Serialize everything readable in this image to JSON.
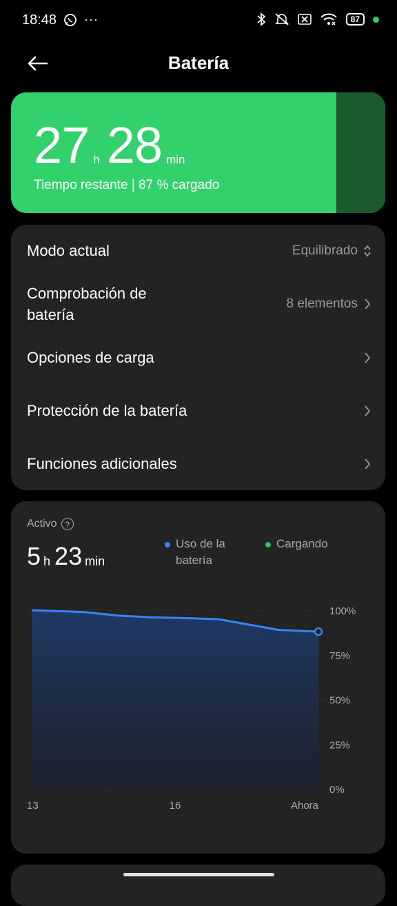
{
  "status_bar": {
    "time": "18:48",
    "battery": "87"
  },
  "header": {
    "title": "Batería"
  },
  "battery_card": {
    "hours": "27",
    "hours_unit": "h",
    "minutes": "28",
    "minutes_unit": "min",
    "subtitle": "Tiempo restante | 87 % cargado",
    "charge_level_pct": 87,
    "accent_color": "#33d16c"
  },
  "settings": [
    {
      "label": "Modo actual",
      "value": "Equilibrado",
      "icon": "updown-chevron-icon"
    },
    {
      "label": "Comprobación de batería",
      "value": "8 elementos",
      "icon": "chevron-right-icon"
    },
    {
      "label": "Opciones de carga",
      "value": "",
      "icon": "chevron-right-icon"
    },
    {
      "label": "Protección de la batería",
      "value": "",
      "icon": "chevron-right-icon"
    },
    {
      "label": "Funciones adicionales",
      "value": "",
      "icon": "chevron-right-icon"
    }
  ],
  "usage": {
    "active_label": "Activo",
    "hours": "5",
    "hours_unit": "h",
    "minutes": "23",
    "minutes_unit": "min",
    "legend": [
      {
        "label": "Uso de la batería",
        "color": "#3b82f6"
      },
      {
        "label": "Cargando",
        "color": "#22c55e"
      }
    ]
  },
  "chart_data": {
    "type": "area",
    "x_ticks": [
      "13",
      "16",
      "Ahora"
    ],
    "y_ticks": [
      "100%",
      "75%",
      "50%",
      "25%",
      "0%"
    ],
    "ylim": [
      0,
      100
    ],
    "series": [
      {
        "name": "Uso de la batería",
        "x": [
          0,
          0.18,
          0.3,
          0.42,
          0.55,
          0.65,
          0.72,
          0.86,
          1
        ],
        "values": [
          100,
          99,
          97,
          96,
          95.5,
          95,
          93,
          89,
          88
        ]
      }
    ]
  }
}
